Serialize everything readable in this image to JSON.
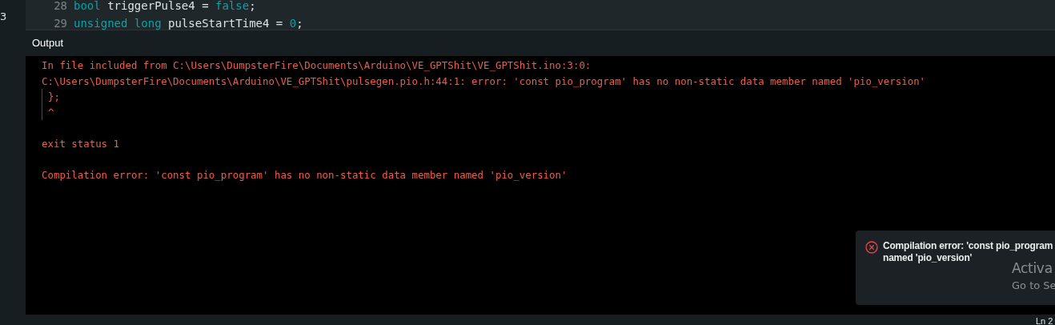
{
  "sidebar": {
    "badge": "3"
  },
  "editor": {
    "lines": [
      {
        "number": "28",
        "tokens": [
          {
            "kind": "keyword",
            "text": "bool"
          },
          {
            "kind": "plain",
            "text": " triggerPulse4 = "
          },
          {
            "kind": "keyword",
            "text": "false"
          },
          {
            "kind": "plain",
            "text": ";"
          }
        ]
      },
      {
        "number": "29",
        "tokens": [
          {
            "kind": "keyword",
            "text": "unsigned long"
          },
          {
            "kind": "plain",
            "text": " pulseStartTime4 = "
          },
          {
            "kind": "keyword",
            "text": "0"
          },
          {
            "kind": "plain",
            "text": ";"
          }
        ]
      }
    ]
  },
  "output": {
    "title": "Output",
    "lines": [
      {
        "kind": "plain",
        "text": "In file included from C:\\Users\\DumpsterFire\\Documents\\Arduino\\VE_GPTShit\\VE_GPTShit.ino:3:0:"
      },
      {
        "kind": "plain",
        "text": "C:\\Users\\DumpsterFire\\Documents\\Arduino\\VE_GPTShit\\pulsegen.pio.h:44:1: error: 'const pio_program' has no non-static data member named 'pio_version'"
      },
      {
        "kind": "guide",
        "text": "};"
      },
      {
        "kind": "guide",
        "text": "^"
      },
      {
        "kind": "blank"
      },
      {
        "kind": "plain",
        "text": "exit status 1"
      },
      {
        "kind": "blank"
      },
      {
        "kind": "plain",
        "text": "Compilation error: 'const pio_program' has no non-static data member named 'pio_version'"
      }
    ]
  },
  "notification": {
    "kind": "error",
    "lines": [
      "Compilation error: 'const pio_program",
      "named 'pio_version'"
    ]
  },
  "activation": {
    "title": "Activa",
    "subtitle": "Go to Se"
  },
  "status_bar": {
    "position": "Ln 2"
  }
}
